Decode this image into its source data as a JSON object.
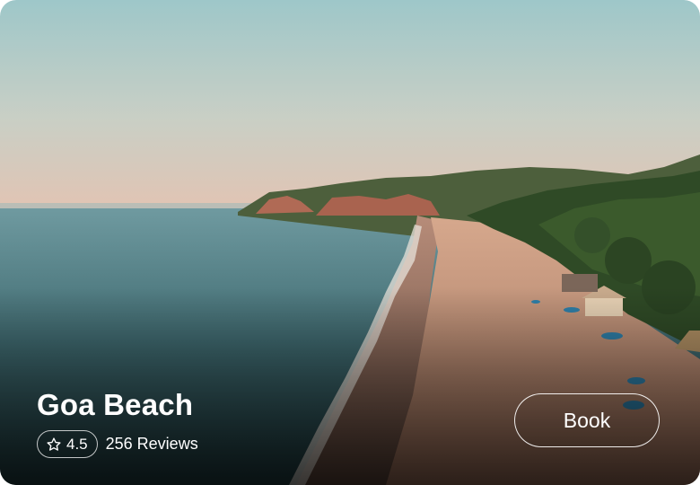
{
  "card": {
    "title": "Goa Beach",
    "rating": "4.5",
    "reviews": "256 Reviews",
    "book_label": "Book"
  },
  "icons": {
    "rating": "star-outline-icon"
  },
  "colors": {
    "text": "#ffffff",
    "sky_top": "#9ec7c9",
    "sky_bottom": "#e3c3b2",
    "sea": "#3f6a70",
    "sand": "#c9957a"
  }
}
